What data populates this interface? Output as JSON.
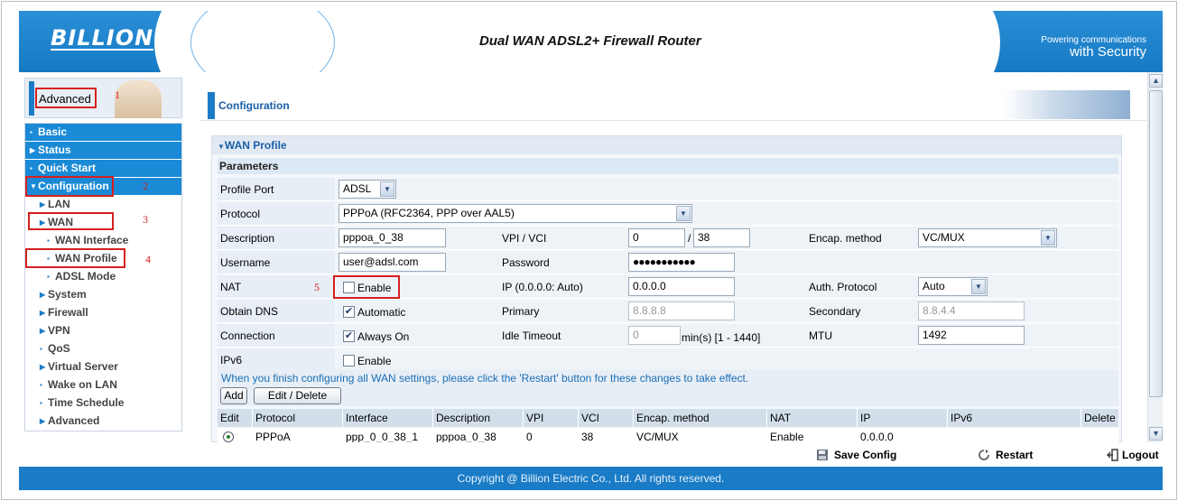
{
  "header": {
    "logo": "BILLION",
    "title": "Dual WAN ADSL2+ Firewall Router",
    "slogan_line1": "Powering communications",
    "slogan_line2": "with Security"
  },
  "sidebar": {
    "header_label": "Advanced",
    "items": [
      {
        "label": "Basic",
        "level": "top"
      },
      {
        "label": "Status",
        "level": "top"
      },
      {
        "label": "Quick Start",
        "level": "top"
      },
      {
        "label": "Configuration",
        "level": "top"
      },
      {
        "label": "LAN",
        "level": "sub"
      },
      {
        "label": "WAN",
        "level": "sub"
      },
      {
        "label": "WAN Interface",
        "level": "sub2"
      },
      {
        "label": "WAN Profile",
        "level": "sub2"
      },
      {
        "label": "ADSL Mode",
        "level": "sub2"
      },
      {
        "label": "System",
        "level": "sub"
      },
      {
        "label": "Firewall",
        "level": "sub"
      },
      {
        "label": "VPN",
        "level": "sub"
      },
      {
        "label": "QoS",
        "level": "sub"
      },
      {
        "label": "Virtual Server",
        "level": "sub"
      },
      {
        "label": "Wake on LAN",
        "level": "sub"
      },
      {
        "label": "Time Schedule",
        "level": "sub"
      },
      {
        "label": "Advanced",
        "level": "sub"
      }
    ]
  },
  "annotations": [
    "1",
    "2",
    "3",
    "4",
    "5"
  ],
  "main": {
    "section_title": "Configuration",
    "panel_title": "WAN Profile",
    "params_label": "Parameters",
    "labels": {
      "profile_port": "Profile Port",
      "protocol": "Protocol",
      "description": "Description",
      "vpi_vci": "VPI / VCI",
      "encap": "Encap. method",
      "username": "Username",
      "password": "Password",
      "nat": "NAT",
      "ip": "IP (0.0.0.0: Auto)",
      "auth": "Auth. Protocol",
      "obtain_dns": "Obtain DNS",
      "primary": "Primary",
      "secondary": "Secondary",
      "connection": "Connection",
      "idle_timeout": "Idle Timeout",
      "mtu": "MTU",
      "ipv6": "IPv6"
    },
    "values": {
      "profile_port": "ADSL",
      "protocol": "PPPoA (RFC2364, PPP over AAL5)",
      "description": "pppoa_0_38",
      "vpi": "0",
      "vci_sep": "/",
      "vci": "38",
      "encap": "VC/MUX",
      "username": "user@adsl.com",
      "password": "●●●●●●●●●●●",
      "nat_label": "Enable",
      "ip": "0.0.0.0",
      "auth": "Auto",
      "dns_label": "Automatic",
      "primary": "8.8.8.8",
      "secondary": "8.8.4.4",
      "connection_label": "Always On",
      "idle_timeout": "0",
      "idle_unit": "min(s) [1 - 1440]",
      "mtu": "1492",
      "ipv6_label": "Enable"
    },
    "notice": "When you finish configuring all WAN settings, please click the 'Restart' button for these changes to take effect.",
    "buttons": {
      "add": "Add",
      "edit_delete": "Edit / Delete"
    },
    "table": {
      "headers": [
        "Edit",
        "Protocol",
        "Interface",
        "Description",
        "VPI",
        "VCI",
        "Encap. method",
        "NAT",
        "IP",
        "IPv6",
        "Delete"
      ],
      "rows": [
        [
          "",
          "PPPoA",
          "ppp_0_0_38_1",
          "pppoa_0_38",
          "0",
          "38",
          "VC/MUX",
          "Enable",
          "0.0.0.0",
          "",
          ""
        ]
      ]
    }
  },
  "actions": {
    "save": "Save Config",
    "restart": "Restart",
    "logout": "Logout"
  },
  "footer": "Copyright @ Billion Electric Co., Ltd. All rights reserved.",
  "colors": {
    "brand_blue": "#1a7cc7",
    "annotation_red": "#d62020"
  }
}
